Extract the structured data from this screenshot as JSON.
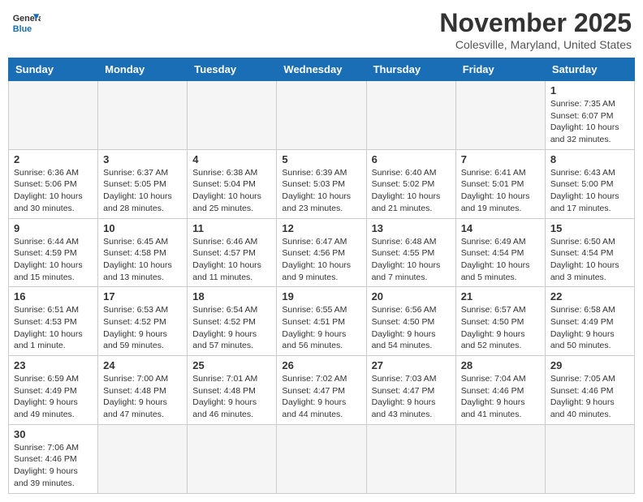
{
  "logo": {
    "text_general": "General",
    "text_blue": "Blue"
  },
  "title": "November 2025",
  "location": "Colesville, Maryland, United States",
  "days_of_week": [
    "Sunday",
    "Monday",
    "Tuesday",
    "Wednesday",
    "Thursday",
    "Friday",
    "Saturday"
  ],
  "weeks": [
    [
      {
        "day": "",
        "info": ""
      },
      {
        "day": "",
        "info": ""
      },
      {
        "day": "",
        "info": ""
      },
      {
        "day": "",
        "info": ""
      },
      {
        "day": "",
        "info": ""
      },
      {
        "day": "",
        "info": ""
      },
      {
        "day": "1",
        "info": "Sunrise: 7:35 AM\nSunset: 6:07 PM\nDaylight: 10 hours and 32 minutes."
      }
    ],
    [
      {
        "day": "2",
        "info": "Sunrise: 6:36 AM\nSunset: 5:06 PM\nDaylight: 10 hours and 30 minutes."
      },
      {
        "day": "3",
        "info": "Sunrise: 6:37 AM\nSunset: 5:05 PM\nDaylight: 10 hours and 28 minutes."
      },
      {
        "day": "4",
        "info": "Sunrise: 6:38 AM\nSunset: 5:04 PM\nDaylight: 10 hours and 25 minutes."
      },
      {
        "day": "5",
        "info": "Sunrise: 6:39 AM\nSunset: 5:03 PM\nDaylight: 10 hours and 23 minutes."
      },
      {
        "day": "6",
        "info": "Sunrise: 6:40 AM\nSunset: 5:02 PM\nDaylight: 10 hours and 21 minutes."
      },
      {
        "day": "7",
        "info": "Sunrise: 6:41 AM\nSunset: 5:01 PM\nDaylight: 10 hours and 19 minutes."
      },
      {
        "day": "8",
        "info": "Sunrise: 6:43 AM\nSunset: 5:00 PM\nDaylight: 10 hours and 17 minutes."
      }
    ],
    [
      {
        "day": "9",
        "info": "Sunrise: 6:44 AM\nSunset: 4:59 PM\nDaylight: 10 hours and 15 minutes."
      },
      {
        "day": "10",
        "info": "Sunrise: 6:45 AM\nSunset: 4:58 PM\nDaylight: 10 hours and 13 minutes."
      },
      {
        "day": "11",
        "info": "Sunrise: 6:46 AM\nSunset: 4:57 PM\nDaylight: 10 hours and 11 minutes."
      },
      {
        "day": "12",
        "info": "Sunrise: 6:47 AM\nSunset: 4:56 PM\nDaylight: 10 hours and 9 minutes."
      },
      {
        "day": "13",
        "info": "Sunrise: 6:48 AM\nSunset: 4:55 PM\nDaylight: 10 hours and 7 minutes."
      },
      {
        "day": "14",
        "info": "Sunrise: 6:49 AM\nSunset: 4:54 PM\nDaylight: 10 hours and 5 minutes."
      },
      {
        "day": "15",
        "info": "Sunrise: 6:50 AM\nSunset: 4:54 PM\nDaylight: 10 hours and 3 minutes."
      }
    ],
    [
      {
        "day": "16",
        "info": "Sunrise: 6:51 AM\nSunset: 4:53 PM\nDaylight: 10 hours and 1 minute."
      },
      {
        "day": "17",
        "info": "Sunrise: 6:53 AM\nSunset: 4:52 PM\nDaylight: 9 hours and 59 minutes."
      },
      {
        "day": "18",
        "info": "Sunrise: 6:54 AM\nSunset: 4:52 PM\nDaylight: 9 hours and 57 minutes."
      },
      {
        "day": "19",
        "info": "Sunrise: 6:55 AM\nSunset: 4:51 PM\nDaylight: 9 hours and 56 minutes."
      },
      {
        "day": "20",
        "info": "Sunrise: 6:56 AM\nSunset: 4:50 PM\nDaylight: 9 hours and 54 minutes."
      },
      {
        "day": "21",
        "info": "Sunrise: 6:57 AM\nSunset: 4:50 PM\nDaylight: 9 hours and 52 minutes."
      },
      {
        "day": "22",
        "info": "Sunrise: 6:58 AM\nSunset: 4:49 PM\nDaylight: 9 hours and 50 minutes."
      }
    ],
    [
      {
        "day": "23",
        "info": "Sunrise: 6:59 AM\nSunset: 4:49 PM\nDaylight: 9 hours and 49 minutes."
      },
      {
        "day": "24",
        "info": "Sunrise: 7:00 AM\nSunset: 4:48 PM\nDaylight: 9 hours and 47 minutes."
      },
      {
        "day": "25",
        "info": "Sunrise: 7:01 AM\nSunset: 4:48 PM\nDaylight: 9 hours and 46 minutes."
      },
      {
        "day": "26",
        "info": "Sunrise: 7:02 AM\nSunset: 4:47 PM\nDaylight: 9 hours and 44 minutes."
      },
      {
        "day": "27",
        "info": "Sunrise: 7:03 AM\nSunset: 4:47 PM\nDaylight: 9 hours and 43 minutes."
      },
      {
        "day": "28",
        "info": "Sunrise: 7:04 AM\nSunset: 4:46 PM\nDaylight: 9 hours and 41 minutes."
      },
      {
        "day": "29",
        "info": "Sunrise: 7:05 AM\nSunset: 4:46 PM\nDaylight: 9 hours and 40 minutes."
      }
    ],
    [
      {
        "day": "30",
        "info": "Sunrise: 7:06 AM\nSunset: 4:46 PM\nDaylight: 9 hours and 39 minutes."
      },
      {
        "day": "",
        "info": ""
      },
      {
        "day": "",
        "info": ""
      },
      {
        "day": "",
        "info": ""
      },
      {
        "day": "",
        "info": ""
      },
      {
        "day": "",
        "info": ""
      },
      {
        "day": "",
        "info": ""
      }
    ]
  ]
}
